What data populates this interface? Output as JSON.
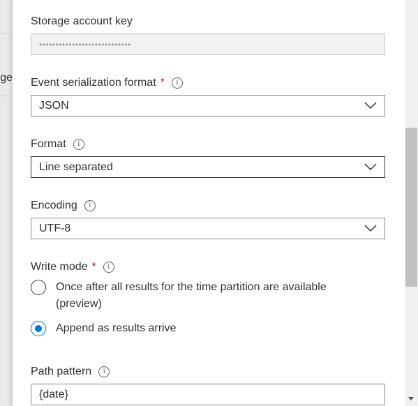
{
  "backdrop": {
    "partial_text": "ge"
  },
  "storage_key": {
    "label": "Storage account key",
    "value": "••••••••••••••••••••••••••••"
  },
  "serialization": {
    "label": "Event serialization format",
    "required_mark": "*",
    "info_glyph": "i",
    "value": "JSON"
  },
  "format": {
    "label": "Format",
    "info_glyph": "i",
    "value": "Line separated"
  },
  "encoding": {
    "label": "Encoding",
    "info_glyph": "i",
    "value": "UTF-8"
  },
  "write_mode": {
    "label": "Write mode",
    "required_mark": "*",
    "info_glyph": "i",
    "options": [
      {
        "label": "Once after all results for the time partition are available (preview)",
        "selected": false
      },
      {
        "label": "Append as results arrive",
        "selected": true
      }
    ]
  },
  "path_pattern": {
    "label": "Path pattern",
    "info_glyph": "i",
    "value": "{date}"
  },
  "colors": {
    "accent": "#0078d4",
    "required": "#a4262c"
  },
  "icons": {
    "dropdown": "chevron-down-icon",
    "info": "info-icon",
    "scroll_down": "scroll-down-arrow-icon"
  }
}
